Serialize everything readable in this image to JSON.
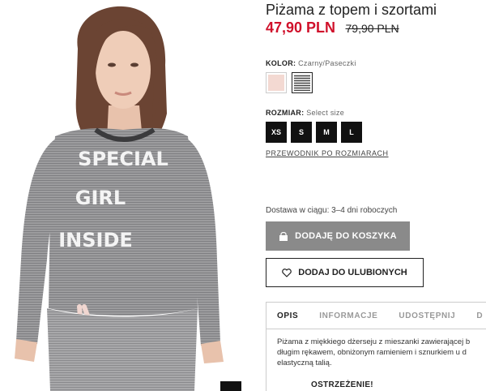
{
  "product": {
    "title": "Piżama z topem i szortami",
    "price_sale": "47,90 PLN",
    "price_old": "79,90 PLN"
  },
  "color": {
    "label": "KOLOR:",
    "value": "Czarny/Paseczki",
    "swatches": [
      "pink",
      "black-stripe"
    ],
    "selected_index": 1
  },
  "size": {
    "label": "ROZMIAR:",
    "value": "Select size",
    "options": [
      "XS",
      "S",
      "M",
      "L"
    ],
    "guide_link": "PRZEWODNIK PO ROZMIARACH"
  },
  "delivery": "Dostawa w ciągu: 3–4 dni roboczych",
  "buttons": {
    "add_to_cart": "DODAJĘ DO KOSZYKA",
    "add_to_favorites": "DODAJ DO ULUBIONYCH"
  },
  "tabs": {
    "items": [
      "OPIS",
      "INFORMACJE",
      "UDOSTĘPNIJ",
      "D"
    ],
    "active": "OPIS",
    "description_lines": [
      "Piżama z miękkiego dżerseju z mieszanki zawierającej b",
      "długim rękawem, obniżonym ramieniem i sznurkiem u d",
      "elastyczną talią."
    ],
    "warning": "OSTRZEŻENIE!"
  },
  "photo": {
    "shirt_text": [
      "SPECIAL",
      "GIRL",
      "INSIDE"
    ]
  },
  "colors": {
    "sale_red": "#d0112b",
    "cart_button_bg": "#8a8a8a",
    "size_button_bg": "#111111"
  }
}
